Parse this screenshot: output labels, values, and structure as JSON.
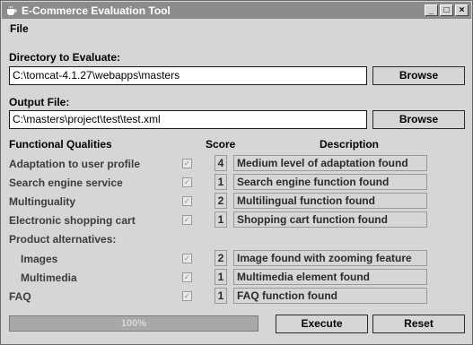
{
  "window": {
    "title": "E-Commerce Evaluation Tool",
    "icon": "java-cup-icon",
    "controls": [
      "_",
      "□",
      "×"
    ]
  },
  "menu": {
    "file": "File"
  },
  "directory": {
    "label": "Directory to Evaluate:",
    "value": "C:\\tomcat-4.1.27\\webapps\\masters",
    "browse": "Browse"
  },
  "output": {
    "label": "Output File:",
    "value": "C:\\masters\\project\\test\\test.xml",
    "browse": "Browse"
  },
  "headers": {
    "qualities": "Functional Qualities",
    "score": "Score",
    "description": "Description"
  },
  "qualities": [
    {
      "label": "Adaptation to user profile",
      "checked": true,
      "score": "4",
      "description": "Medium level of adaptation found"
    },
    {
      "label": "Search engine service",
      "checked": true,
      "score": "1",
      "description": "Search engine function found"
    },
    {
      "label": "Multinguality",
      "checked": true,
      "score": "2",
      "description": "Multilingual function found"
    },
    {
      "label": "Electronic shopping cart",
      "checked": true,
      "score": "1",
      "description": "Shopping cart function found"
    }
  ],
  "product_alternatives": {
    "label": "Product alternatives:"
  },
  "sub_qualities": [
    {
      "label": "Images",
      "checked": true,
      "score": "2",
      "description": "Image found with zooming feature"
    },
    {
      "label": "Multimedia",
      "checked": true,
      "score": "1",
      "description": "Multimedia element found"
    }
  ],
  "faq": {
    "label": "FAQ",
    "checked": true,
    "score": "1",
    "description": "FAQ function found"
  },
  "progress": {
    "text": "100%",
    "value": 1.0
  },
  "actions": {
    "execute": "Execute",
    "reset": "Reset"
  },
  "colors": {
    "titlebar": "#8c8c8c",
    "panel": "#d6d6d6",
    "disabled_text": "#3c3c3c"
  }
}
